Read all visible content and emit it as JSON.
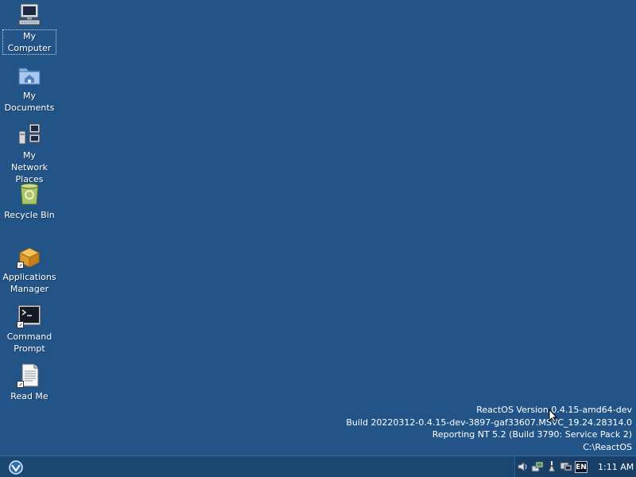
{
  "desktop": {
    "icons": [
      {
        "label": "My Computer",
        "icon": "computer-icon",
        "selected": true
      },
      {
        "label": "My Documents",
        "icon": "documents-folder-icon"
      },
      {
        "label": "My Network Places",
        "icon": "network-places-icon"
      },
      {
        "label": "Recycle Bin",
        "icon": "recycle-bin-icon"
      },
      {
        "label": "Applications Manager",
        "icon": "applications-manager-icon"
      },
      {
        "label": "Command Prompt",
        "icon": "command-prompt-icon"
      },
      {
        "label": "Read Me",
        "icon": "read-me-icon"
      }
    ],
    "version_info": [
      "ReactOS Version 0.4.15-amd64-dev",
      "Build 20220312-0.4.15-dev-3897-gaf33607.MSVC_19.24.28314.0",
      "Reporting NT 5.2 (Build 3790: Service Pack 2)",
      "C:\\ReactOS"
    ],
    "background_color": "#235488"
  },
  "taskbar": {
    "start_icon": "reactos-start-icon",
    "tray": {
      "icons": [
        "volume-icon",
        "network-connection-icon",
        "safely-remove-hardware-icon",
        "display-monitor-icon"
      ],
      "language": "EN",
      "clock": "1:11 AM"
    }
  }
}
